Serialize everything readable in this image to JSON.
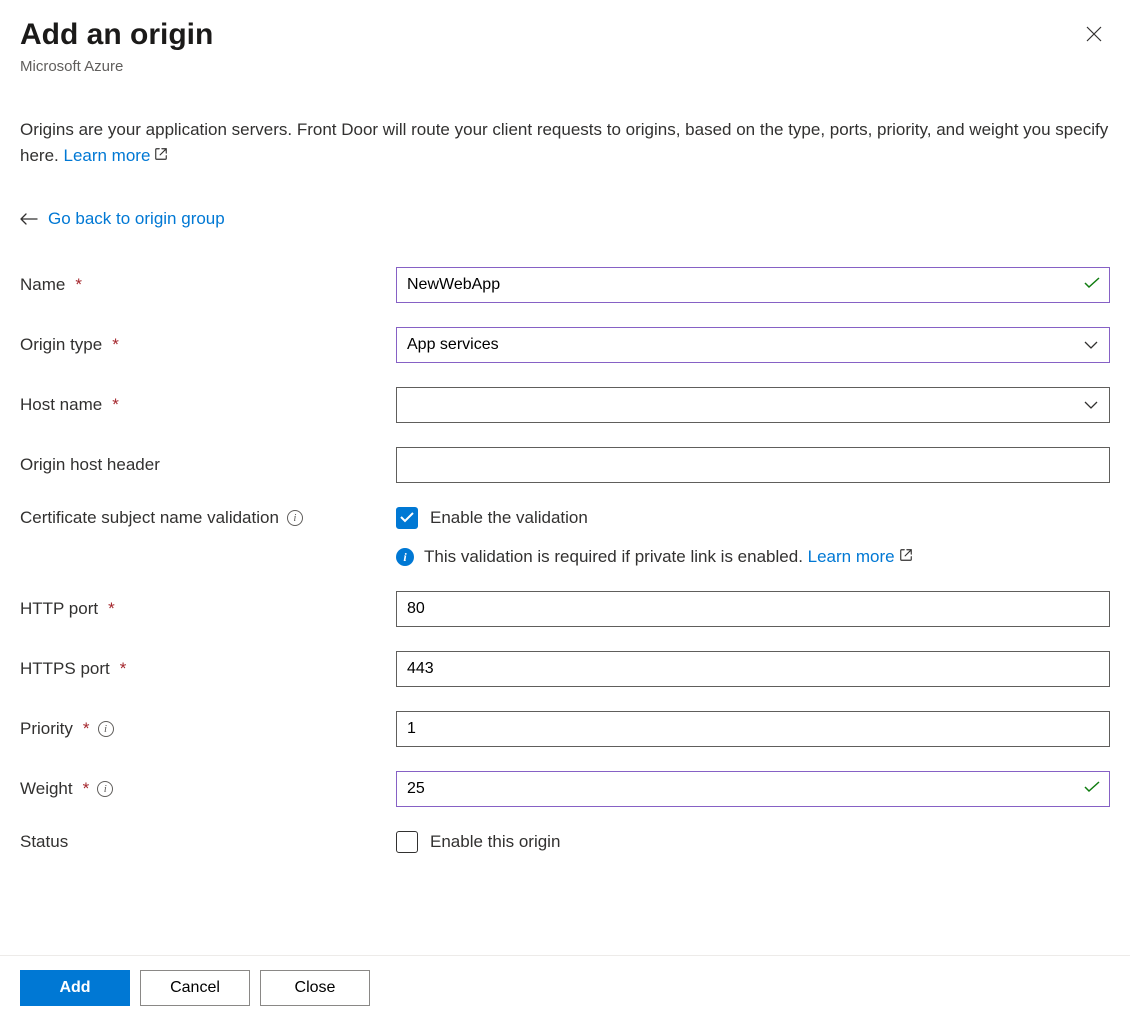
{
  "header": {
    "title": "Add an origin",
    "subtitle": "Microsoft Azure"
  },
  "description": {
    "text": "Origins are your application servers. Front Door will route your client requests to origins, based on the type, ports, priority, and weight you specify here. ",
    "learn_more": "Learn more"
  },
  "back_link": "Go back to origin group",
  "labels": {
    "name": "Name",
    "origin_type": "Origin type",
    "host_name": "Host name",
    "origin_host_header": "Origin host header",
    "cert_validation": "Certificate subject name validation",
    "http_port": "HTTP port",
    "https_port": "HTTPS port",
    "priority": "Priority",
    "weight": "Weight",
    "status": "Status"
  },
  "values": {
    "name": "NewWebApp",
    "origin_type": "App services",
    "host_name": "",
    "origin_host_header": "",
    "enable_validation_label": "Enable the validation",
    "enable_validation_checked": true,
    "validation_note": "This validation is required if private link is enabled. ",
    "validation_learn_more": "Learn more",
    "http_port": "80",
    "https_port": "443",
    "priority": "1",
    "weight": "25",
    "enable_origin_label": "Enable this origin",
    "enable_origin_checked": false
  },
  "footer": {
    "add": "Add",
    "cancel": "Cancel",
    "close": "Close"
  }
}
